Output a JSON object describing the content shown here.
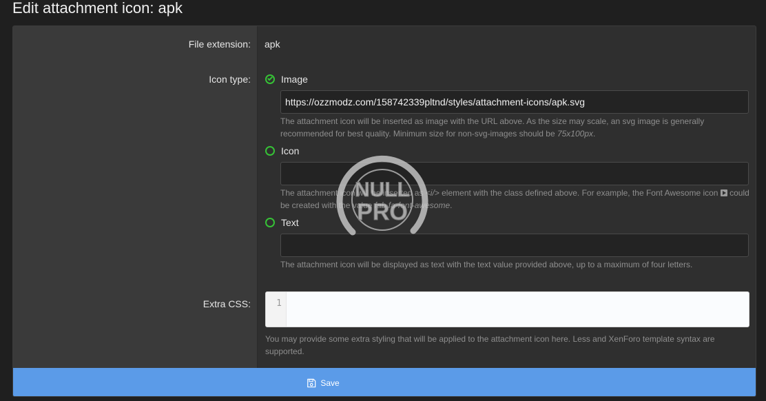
{
  "page": {
    "title": "Edit attachment icon: apk"
  },
  "fields": {
    "file_extension": {
      "label": "File extension:",
      "value": "apk"
    },
    "icon_type": {
      "label": "Icon type:",
      "options": {
        "image": {
          "label": "Image",
          "checked": true,
          "value": "https://ozzmodz.com/158742339pltnd/styles/attachment-icons/apk.svg",
          "hint_main": "The attachment icon will be inserted as image with the URL above. As the size may scale, an svg image is generally recommended for best quality. Minimum size for non-svg-images should be ",
          "hint_em": "75x100px",
          "hint_end": "."
        },
        "icon": {
          "label": "Icon",
          "checked": false,
          "value": "",
          "hint_part1": "The attachment icon will be inserted as ",
          "hint_code": "<i/>",
          "hint_part2": " element with the class defined above. For example, the Font Awesome icon ",
          "hint_part3": " could be created with the value ",
          "hint_em": "fab fa-font-awesome",
          "hint_end": "."
        },
        "text": {
          "label": "Text",
          "checked": false,
          "value": "",
          "hint": "The attachment icon will be displayed as text with the text value provided above, up to a maximum of four letters."
        }
      }
    },
    "extra_css": {
      "label": "Extra CSS:",
      "line_number": "1",
      "value": "",
      "hint": "You may provide some extra styling that will be applied to the attachment icon here. Less and XenForo template syntax are supported."
    }
  },
  "actions": {
    "save_label": "Save"
  },
  "watermark": {
    "line1": "NULL",
    "line2": "PRO"
  },
  "colors": {
    "accent": "#5b9be8",
    "radio": "#36c236",
    "panel": "#2f2f2f",
    "label_column": "#3a3a3a"
  }
}
